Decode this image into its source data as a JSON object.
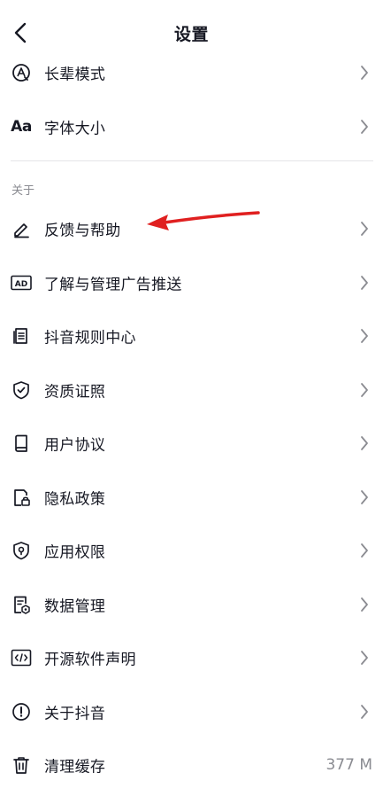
{
  "header": {
    "title": "设置"
  },
  "rows_top": [
    {
      "label": "长辈模式",
      "icon": "elder-mode-icon"
    },
    {
      "label": "字体大小",
      "icon": "font-size-icon",
      "icon_text": "Aa"
    }
  ],
  "about": {
    "section_label": "关于",
    "items": [
      {
        "label": "反馈与帮助",
        "icon": "pencil-icon"
      },
      {
        "label": "了解与管理广告推送",
        "icon": "ad-icon",
        "icon_text": "AD"
      },
      {
        "label": "抖音规则中心",
        "icon": "rules-document-icon"
      },
      {
        "label": "资质证照",
        "icon": "shield-check-icon"
      },
      {
        "label": "用户协议",
        "icon": "book-icon"
      },
      {
        "label": "隐私政策",
        "icon": "privacy-lock-icon"
      },
      {
        "label": "应用权限",
        "icon": "permission-shield-icon"
      },
      {
        "label": "数据管理",
        "icon": "data-management-icon"
      },
      {
        "label": "开源软件声明",
        "icon": "code-icon"
      },
      {
        "label": "关于抖音",
        "icon": "info-icon"
      },
      {
        "label": "清理缓存",
        "icon": "trash-icon",
        "value": "377 M"
      }
    ]
  },
  "colors": {
    "annotation_arrow": "#e02020",
    "text_primary": "#161823",
    "text_secondary": "#8a8b91",
    "divider": "#e5e5e8"
  }
}
